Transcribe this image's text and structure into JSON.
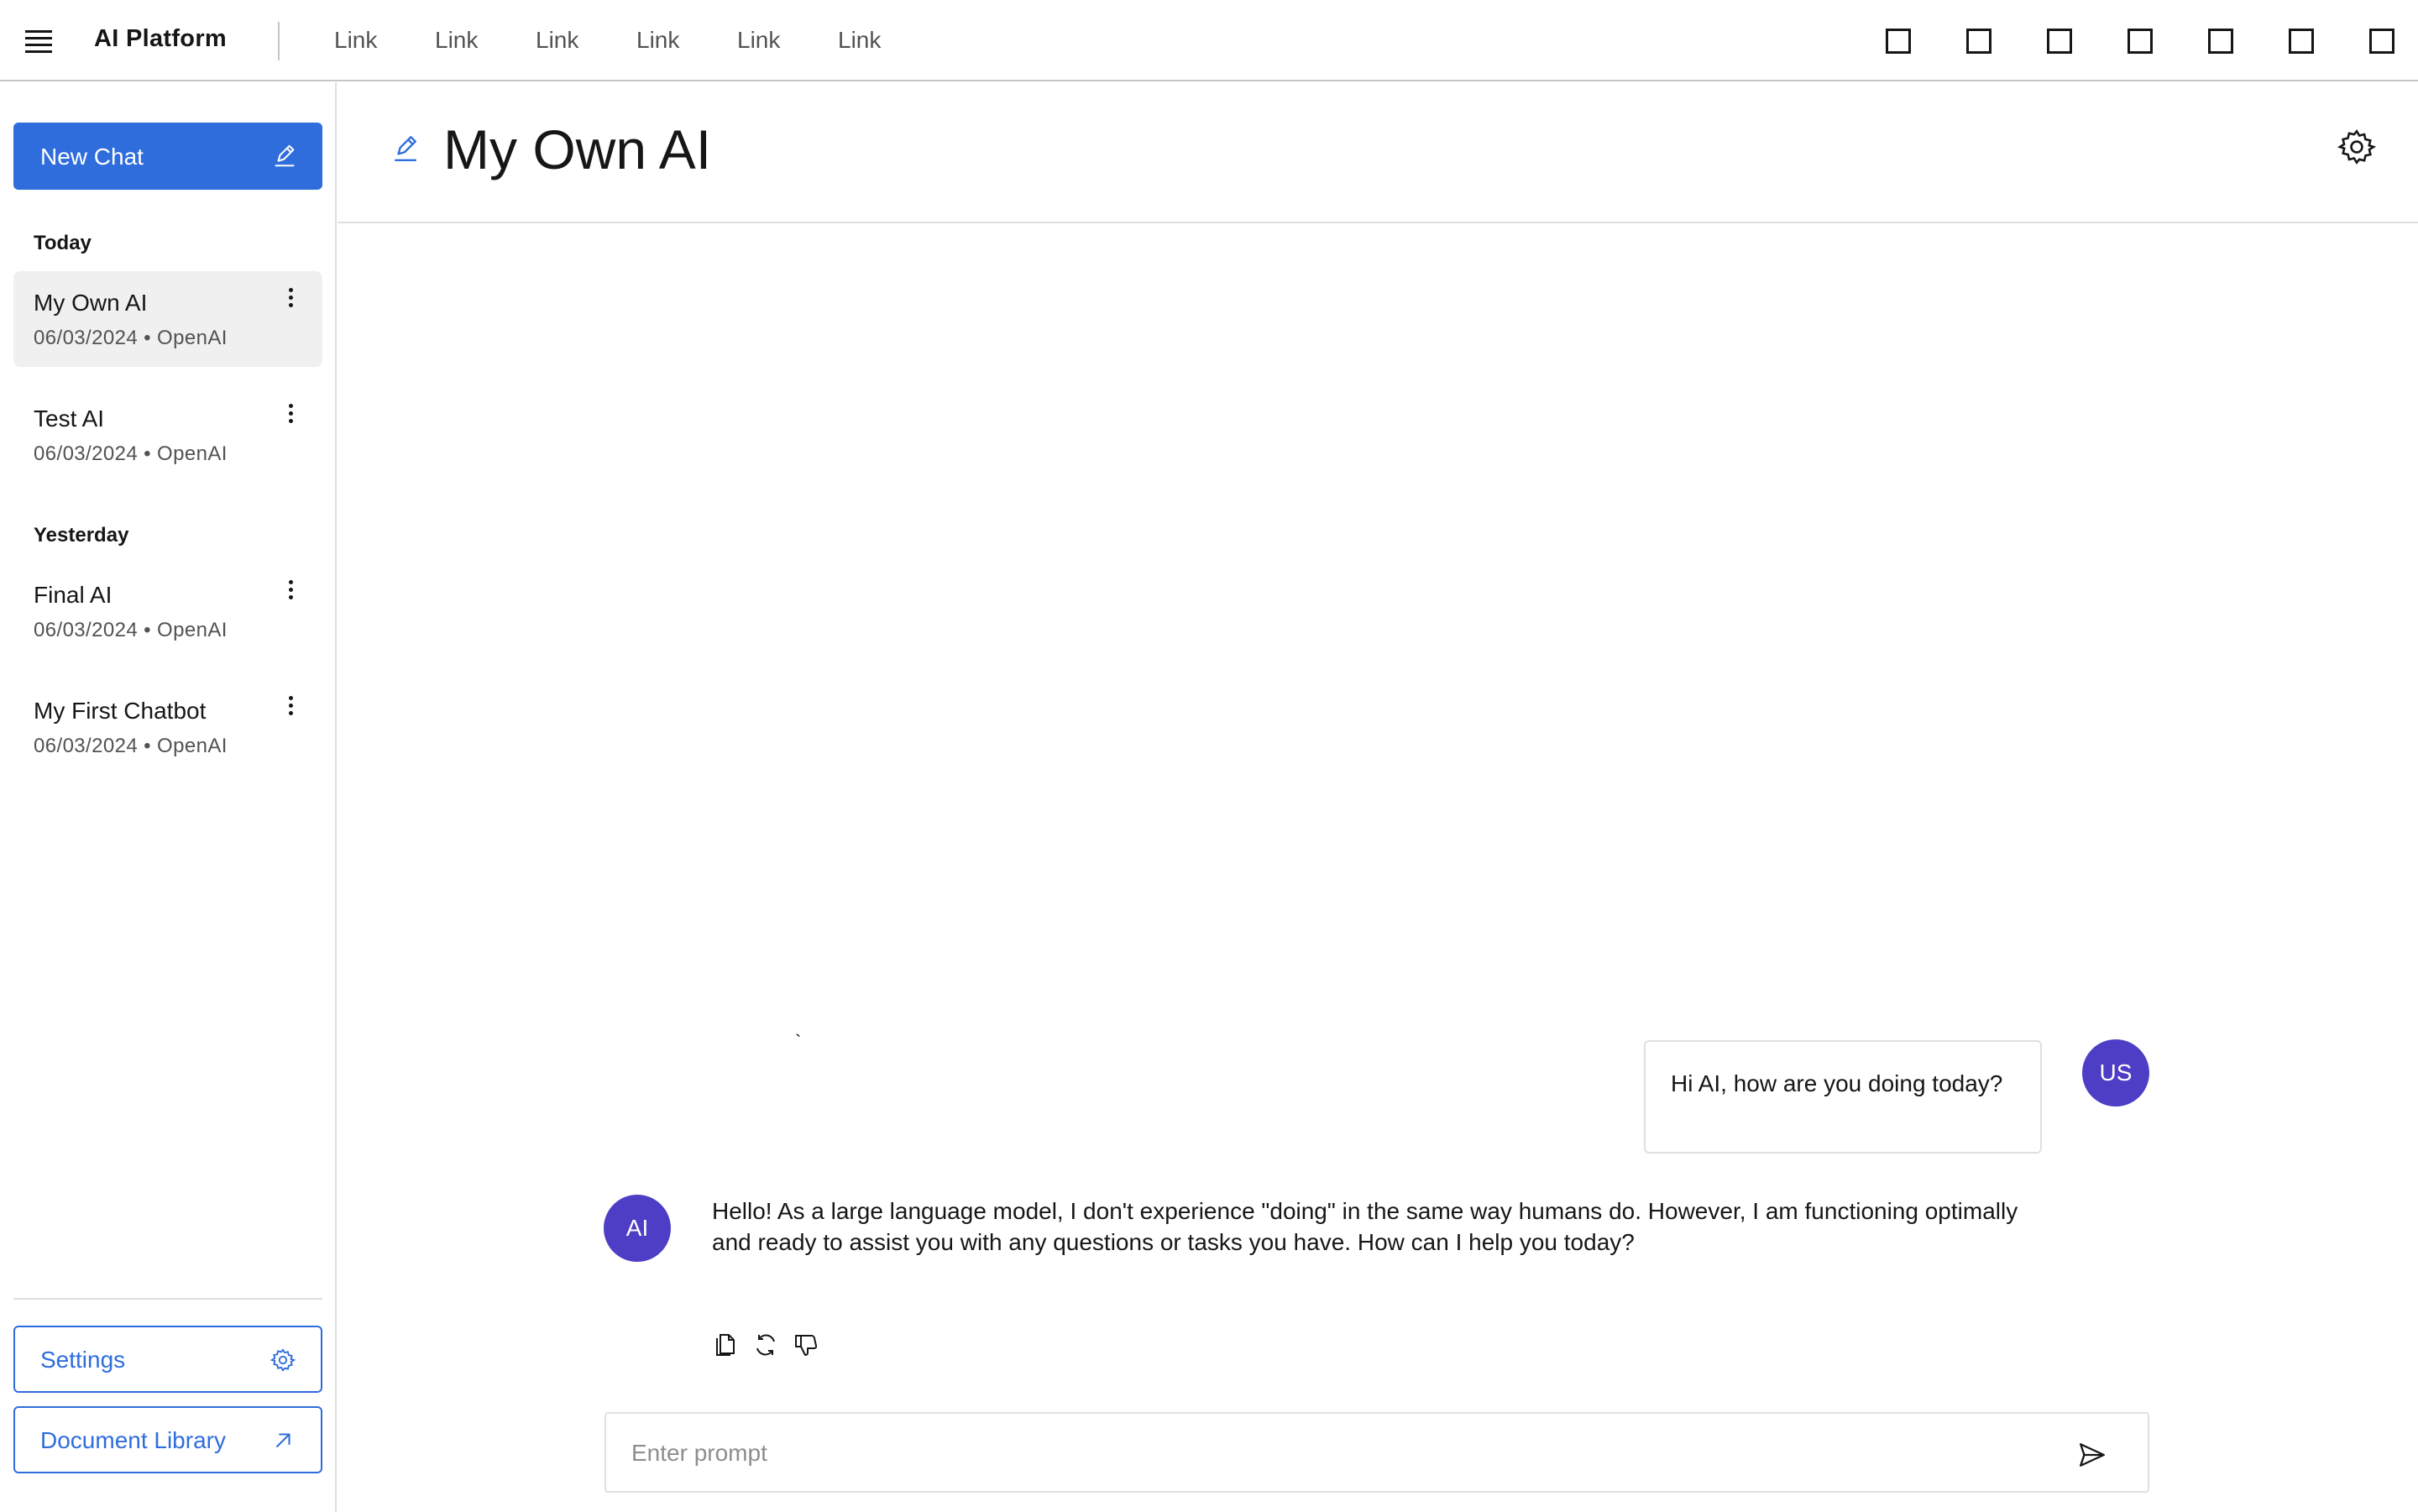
{
  "header": {
    "brand": "AI Platform",
    "nav_links": [
      "Link",
      "Link",
      "Link",
      "Link",
      "Link",
      "Link"
    ],
    "utility_icons": [
      "square-icon",
      "square-icon",
      "square-icon",
      "square-icon",
      "square-icon",
      "square-icon",
      "square-icon"
    ]
  },
  "sidebar": {
    "new_chat_label": "New Chat",
    "sections": [
      {
        "heading": "Today",
        "items": [
          {
            "title": "My Own AI",
            "meta": "06/03/2024 • OpenAI",
            "active": true
          },
          {
            "title": "Test AI",
            "meta": "06/03/2024 • OpenAI",
            "active": false
          }
        ]
      },
      {
        "heading": "Yesterday",
        "items": [
          {
            "title": "Final AI",
            "meta": "06/03/2024 • OpenAI",
            "active": false
          },
          {
            "title": "My First Chatbot",
            "meta": "06/03/2024 • OpenAI",
            "active": false
          }
        ]
      }
    ],
    "settings_label": "Settings",
    "doc_library_label": "Document Library"
  },
  "main": {
    "title": "My Own AI",
    "stray_mark": "`",
    "user_message": {
      "avatar": "US",
      "text": "Hi AI, how are you doing today?"
    },
    "ai_message": {
      "avatar": "AI",
      "text": "Hello! As a large language model, I don't experience \"doing\" in the same way humans do. However, I am functioning optimally and ready to assist you with any questions or tasks you have. How can I help you today?"
    },
    "message_actions": [
      "copy-icon",
      "regenerate-icon",
      "thumbs-down-icon"
    ],
    "prompt": {
      "placeholder": "Enter prompt",
      "value": ""
    }
  },
  "colors": {
    "accent": "#2f6ddc",
    "avatar": "#4d3ec5",
    "active_item_bg": "#f0f0f0",
    "border": "#e0e0e0"
  }
}
